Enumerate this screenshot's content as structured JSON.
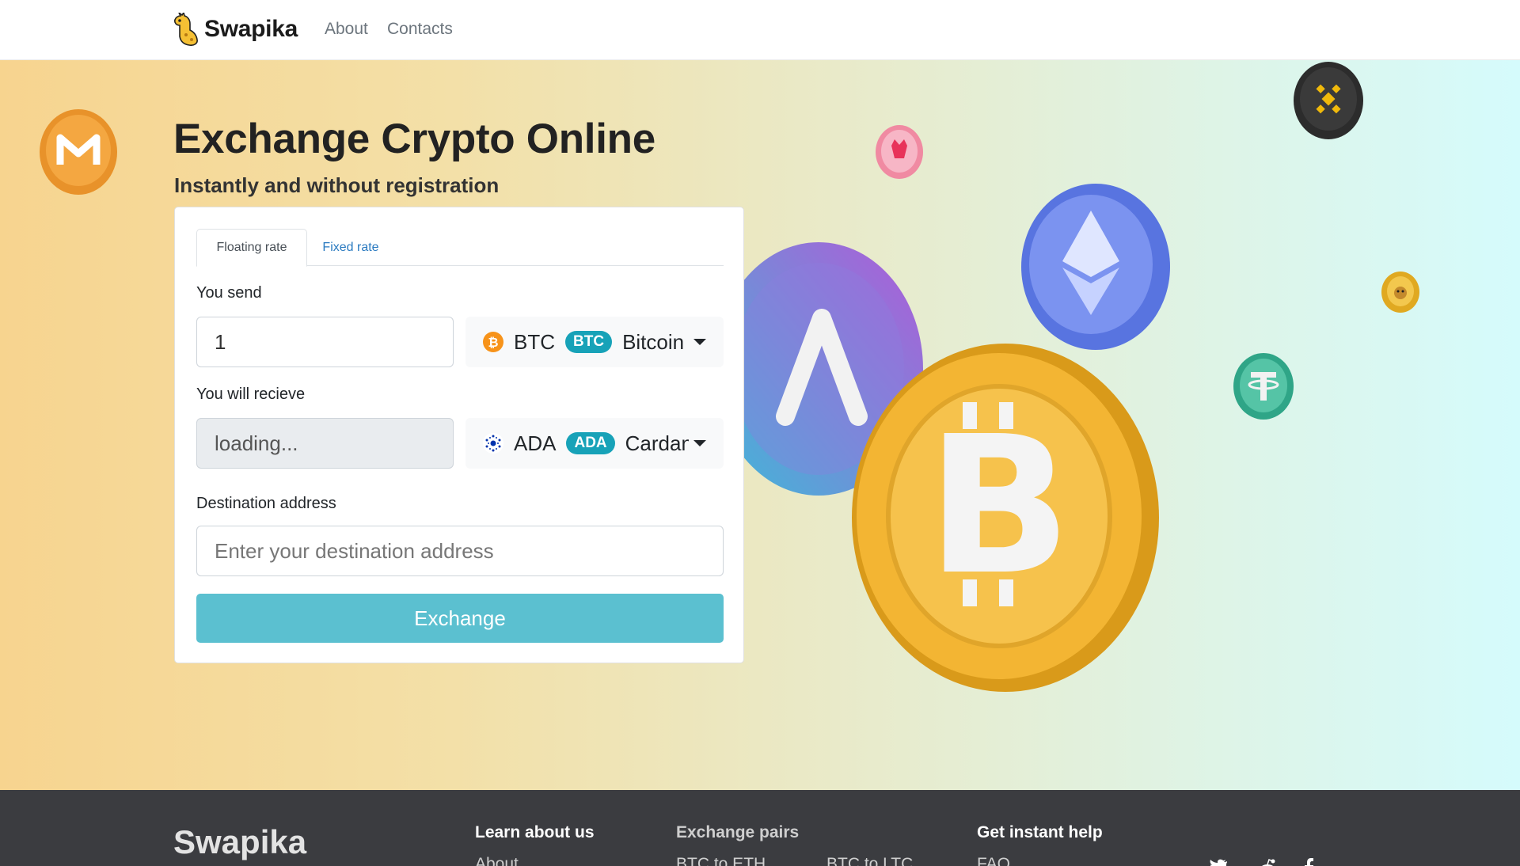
{
  "navbar": {
    "brand": "Swapika",
    "links": [
      "About",
      "Contacts"
    ]
  },
  "hero": {
    "title": "Exchange Crypto Online",
    "subtitle": "Instantly and without registration"
  },
  "form": {
    "tabs": [
      {
        "label": "Floating rate",
        "active": true
      },
      {
        "label": "Fixed rate",
        "active": false
      }
    ],
    "send": {
      "label": "You send",
      "value": "1",
      "coin": {
        "ticker": "BTC",
        "badge": "BTC",
        "name": "Bitcoin",
        "icon": "bitcoin-icon",
        "color": "#f7931a"
      }
    },
    "receive": {
      "label": "You will recieve",
      "value": "loading...",
      "coin": {
        "ticker": "ADA",
        "badge": "ADA",
        "name": "Cardano",
        "icon": "cardano-icon",
        "color": "#0033ad"
      }
    },
    "destination": {
      "label": "Destination address",
      "placeholder": "Enter your destination address"
    },
    "submit_label": "Exchange"
  },
  "decorations": [
    "monero-icon",
    "binance-icon",
    "shiba-icon",
    "ethereum-icon",
    "aave-icon",
    "bitcoin-icon",
    "tether-icon",
    "dogecoin-icon"
  ],
  "footer": {
    "brand": "Swapika",
    "learn": {
      "heading": "Learn about us",
      "links": [
        "About"
      ]
    },
    "pairs": {
      "heading": "Exchange pairs",
      "links": [
        "BTC to ETH",
        "BTC to LTC"
      ]
    },
    "help": {
      "heading": "Get instant help",
      "links": [
        "FAQ"
      ]
    },
    "social": [
      "twitter-icon",
      "reddit-icon",
      "facebook-icon"
    ]
  },
  "colors": {
    "accent": "#5bc0d0",
    "badge": "#17a2b8",
    "link": "#2a7ac0",
    "footer_bg": "#3b3c40"
  }
}
